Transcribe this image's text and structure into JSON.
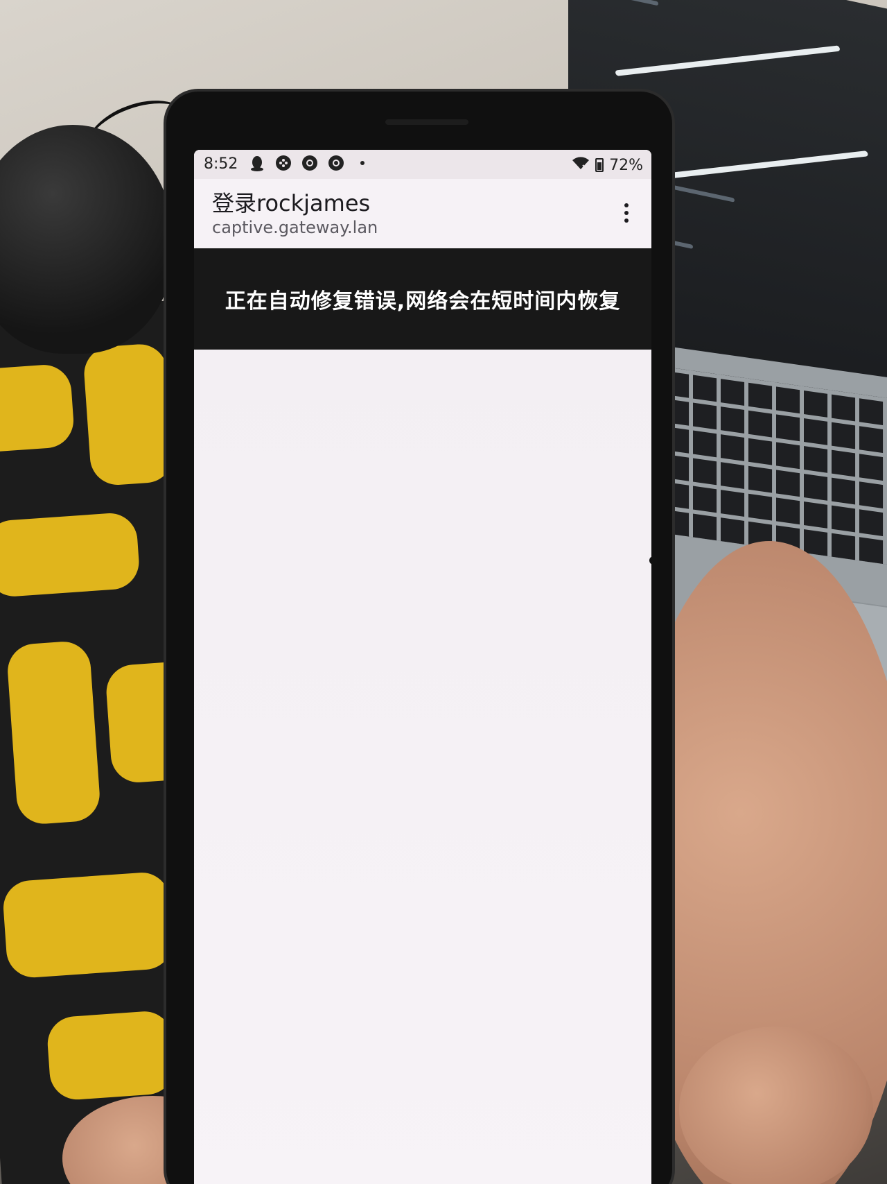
{
  "status_bar": {
    "time": "8:52",
    "battery": "72%",
    "notification_icons": [
      "qq-penguin-icon",
      "game-controller-icon",
      "chrome-icon",
      "chrome-icon"
    ]
  },
  "app_bar": {
    "title": "登录rockjames",
    "url": "captive.gateway.lan"
  },
  "banner": {
    "message": "正在自动修复错误,网络会在短时间内恢复"
  },
  "colors": {
    "banner_background": "#181818",
    "banner_text": "#ffffff",
    "page_background": "#f3eff3"
  }
}
